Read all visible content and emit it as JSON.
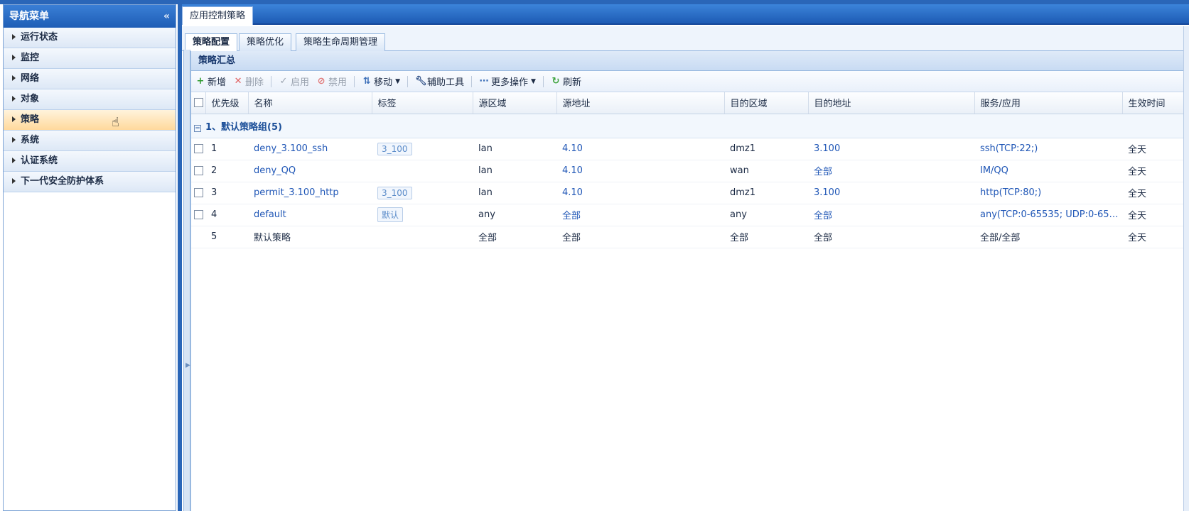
{
  "sidebar": {
    "title": "导航菜单",
    "collapse_icon": "«",
    "items": [
      {
        "label": "运行状态"
      },
      {
        "label": "监控"
      },
      {
        "label": "网络"
      },
      {
        "label": "对象"
      },
      {
        "label": "策略",
        "active": true
      },
      {
        "label": "系统"
      },
      {
        "label": "认证系统"
      },
      {
        "label": "下一代安全防护体系"
      }
    ]
  },
  "main": {
    "top_tab": "应用控制策略",
    "sub_tabs": [
      "策略配置",
      "策略优化",
      "策略生命周期管理"
    ],
    "panel_title": "策略汇总",
    "toolbar": {
      "add": "新增",
      "delete": "删除",
      "enable": "启用",
      "disable": "禁用",
      "move": "移动",
      "tools": "辅助工具",
      "more": "更多操作",
      "refresh": "刷新"
    },
    "columns": [
      "优先级",
      "名称",
      "标签",
      "源区域",
      "源地址",
      "目的区域",
      "目的地址",
      "服务/应用",
      "生效时间"
    ],
    "group_label": "1、默认策略组(5)",
    "rows": [
      {
        "priority": "1",
        "name": "deny_3.100_ssh",
        "tag": "3_100",
        "src_zone": "lan",
        "src_addr": "4.10",
        "dst_zone": "dmz1",
        "dst_addr": "3.100",
        "service": "ssh(TCP:22;)",
        "time": "全天"
      },
      {
        "priority": "2",
        "name": "deny_QQ",
        "tag": "",
        "src_zone": "lan",
        "src_addr": "4.10",
        "dst_zone": "wan",
        "dst_addr": "全部",
        "service": "IM/QQ",
        "time": "全天"
      },
      {
        "priority": "3",
        "name": "permit_3.100_http",
        "tag": "3_100",
        "src_zone": "lan",
        "src_addr": "4.10",
        "dst_zone": "dmz1",
        "dst_addr": "3.100",
        "service": "http(TCP:80;)",
        "time": "全天"
      },
      {
        "priority": "4",
        "name": "default",
        "tag": "默认",
        "src_zone": "any",
        "src_addr": "全部",
        "dst_zone": "any",
        "dst_addr": "全部",
        "service": "any(TCP:0-65535; UDP:0-655...",
        "time": "全天"
      },
      {
        "priority": "5",
        "name": "默认策略",
        "tag": "",
        "src_zone": "全部",
        "src_addr": "全部",
        "dst_zone": "全部",
        "dst_addr": "全部",
        "service": "全部/全部",
        "time": "全天"
      }
    ]
  },
  "colors": {
    "accent": "#2a66b8",
    "link": "#1f56b6",
    "active_nav": "#ffd99c"
  }
}
